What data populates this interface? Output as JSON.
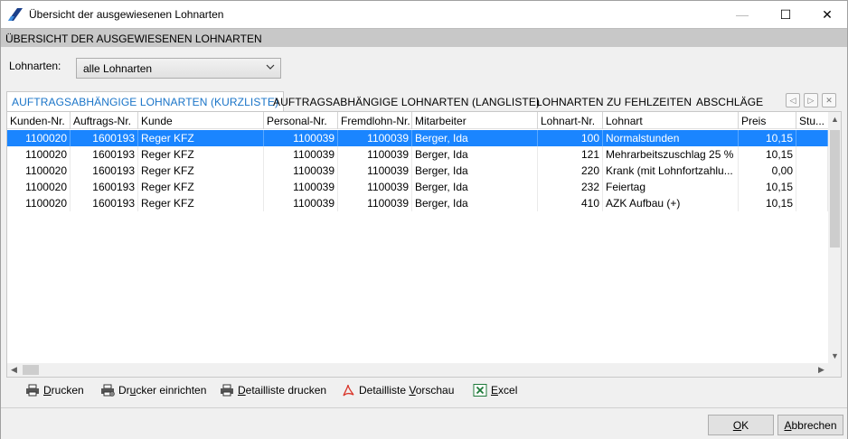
{
  "window": {
    "title": "Übersicht der ausgewiesenen Lohnarten",
    "min_glyph": "—",
    "max_glyph": "☐",
    "close_glyph": "✕"
  },
  "section_header": "ÜBERSICHT DER AUSGEWIESENEN LOHNARTEN",
  "filter": {
    "label": "Lohnarten:",
    "value": "alle Lohnarten"
  },
  "tabs": [
    {
      "label": "AUFTRAGSABHÄNGIGE LOHNARTEN (KURZLISTE)",
      "active": true
    },
    {
      "label": "AUFTRAGSABHÄNGIGE LOHNARTEN (LANGLISTE)",
      "active": false
    },
    {
      "label": "LOHNARTEN ZU FEHLZEITEN",
      "active": false
    },
    {
      "label": "ABSCHLÄGE",
      "active": false
    }
  ],
  "tab_nav": {
    "prev": "◁",
    "next": "▷",
    "close": "✕"
  },
  "grid": {
    "columns": [
      "Kunden-Nr.",
      "Auftrags-Nr.",
      "Kunde",
      "Personal-Nr.",
      "Fremdlohn-Nr.",
      "Mitarbeiter",
      "Lohnart-Nr.",
      "Lohnart",
      "Preis",
      "Stu..."
    ],
    "rows": [
      [
        "1100020",
        "1600193",
        "Reger KFZ",
        "1100039",
        "1100039",
        "Berger, Ida",
        "100",
        "Normalstunden",
        "10,15",
        ""
      ],
      [
        "1100020",
        "1600193",
        "Reger KFZ",
        "1100039",
        "1100039",
        "Berger, Ida",
        "121",
        "Mehrarbeitszuschlag 25 %",
        "10,15",
        ""
      ],
      [
        "1100020",
        "1600193",
        "Reger KFZ",
        "1100039",
        "1100039",
        "Berger, Ida",
        "220",
        "Krank (mit Lohnfortzahlu...",
        "0,00",
        ""
      ],
      [
        "1100020",
        "1600193",
        "Reger KFZ",
        "1100039",
        "1100039",
        "Berger, Ida",
        "232",
        "Feiertag",
        "10,15",
        ""
      ],
      [
        "1100020",
        "1600193",
        "Reger KFZ",
        "1100039",
        "1100039",
        "Berger, Ida",
        "410",
        "AZK Aufbau (+)",
        "10,15",
        ""
      ]
    ],
    "selected_row": 0
  },
  "scroll": {
    "up": "▲",
    "down": "▼",
    "left": "◀",
    "right": "▶"
  },
  "toolbar": {
    "print": {
      "pre": "",
      "u": "D",
      "post": "rucken"
    },
    "printer_setup": {
      "pre": "Dr",
      "u": "u",
      "post": "cker einrichten"
    },
    "detail_print": {
      "pre": "",
      "u": "D",
      "post": "etailliste drucken"
    },
    "detail_preview": {
      "pre": "Detailliste ",
      "u": "V",
      "post": "orschau"
    },
    "excel": {
      "pre": "",
      "u": "E",
      "post": "xcel"
    }
  },
  "buttons": {
    "ok": {
      "pre": "",
      "u": "O",
      "post": "K"
    },
    "cancel": {
      "pre": "",
      "u": "A",
      "post": "bbrechen"
    }
  },
  "colors": {
    "selection": "#1a85ff",
    "active_tab_text": "#1a74c8",
    "pdf_icon": "#d9362b",
    "excel_icon": "#1f7a3a"
  }
}
